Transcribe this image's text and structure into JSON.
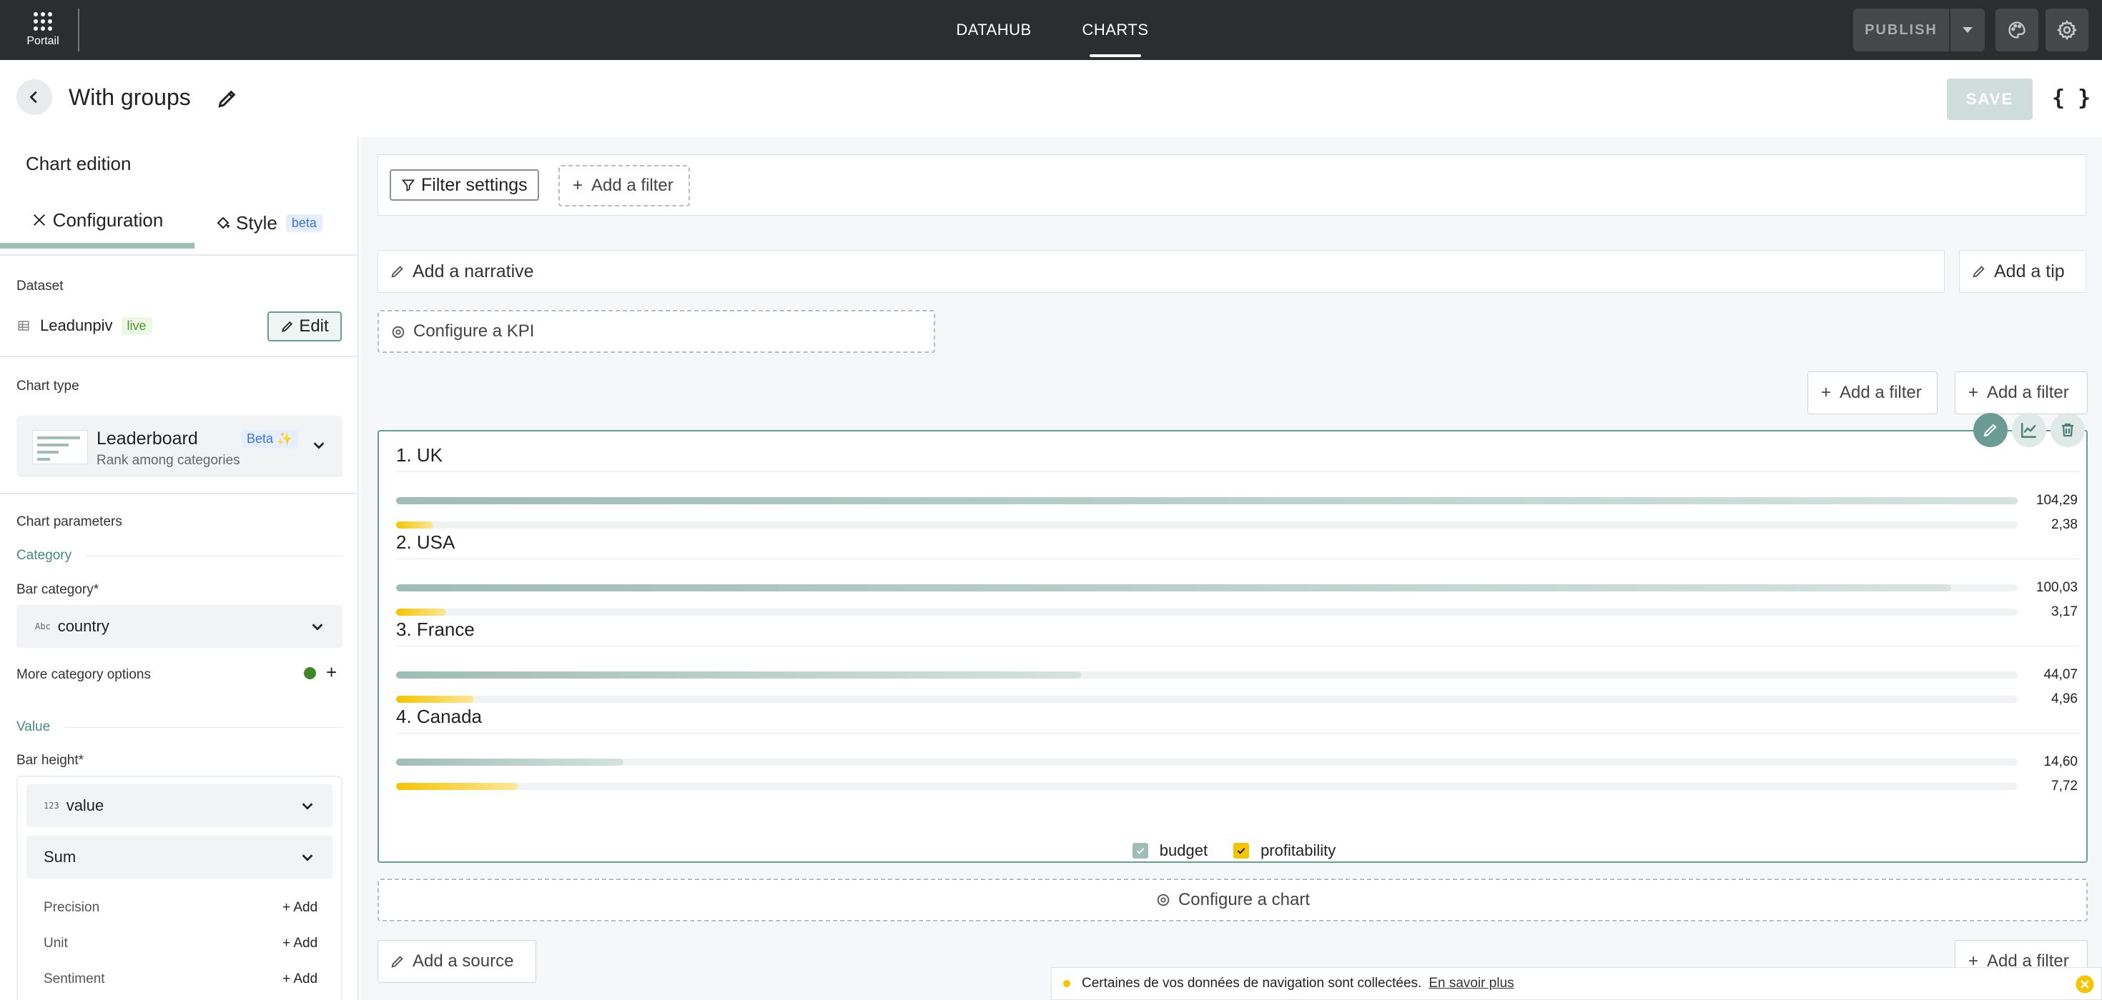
{
  "topbar": {
    "portail_label": "Portail",
    "nav": [
      {
        "label": "DATAHUB"
      },
      {
        "label": "CHARTS",
        "active": true
      }
    ],
    "publish_label": "PUBLISH"
  },
  "header": {
    "title": "With groups",
    "save_label": "SAVE",
    "json_label": "{ }"
  },
  "sidebar": {
    "title": "Chart edition",
    "tabs": [
      {
        "label": "Configuration"
      },
      {
        "label": "Style",
        "badge": "beta"
      }
    ],
    "dataset": {
      "label": "Dataset",
      "name": "Leadunpiv",
      "badge": "live",
      "edit_label": "Edit"
    },
    "chart_type": {
      "label": "Chart type",
      "name": "Leaderboard",
      "badge": "Beta ✨",
      "description": "Rank among categories"
    },
    "params": {
      "title": "Chart parameters",
      "category_section": "Category",
      "bar_category_label": "Bar category*",
      "bar_category_type": "Abc",
      "bar_category_value": "country",
      "more_options_label": "More category options",
      "value_section": "Value",
      "bar_height_label": "Bar height*",
      "bar_height_type": "123",
      "bar_height_value": "value",
      "aggregation": "Sum",
      "rows": [
        {
          "label": "Precision",
          "add": "Add"
        },
        {
          "label": "Unit",
          "add": "Add"
        },
        {
          "label": "Sentiment",
          "add": "Add"
        }
      ]
    }
  },
  "main": {
    "filter_settings_label": "Filter settings",
    "add_filter_label": "Add a filter",
    "narrative_label": "Add a narrative",
    "tip_label": "Add a tip",
    "kpi_label": "Configure a KPI",
    "configure_chart_label": "Configure a chart",
    "source_label": "Add a source"
  },
  "chart_data": {
    "type": "bar",
    "orientation": "horizontal leaderboard",
    "categories": [
      "1. UK",
      "2. USA",
      "3. France",
      "4. Canada"
    ],
    "series": [
      {
        "name": "budget",
        "values": [
          104.29,
          100.03,
          44.07,
          14.6
        ],
        "labels": [
          "104,29",
          "100,03",
          "44,07",
          "14,60"
        ],
        "color": "#9fbdb5"
      },
      {
        "name": "profitability",
        "values": [
          2.38,
          3.17,
          4.96,
          7.72
        ],
        "labels": [
          "2,38",
          "3,17",
          "4,96",
          "7,72"
        ],
        "color": "#f5c400"
      }
    ],
    "legend_position": "bottom-center"
  },
  "cookie": {
    "text": "Certaines de vos données de navigation sont collectées.",
    "link": "En savoir plus"
  },
  "colors": {
    "accent": "#6b9c94",
    "topbar": "#2b2d2f",
    "budget": "#9fbdb5",
    "profitability": "#f5c400"
  }
}
